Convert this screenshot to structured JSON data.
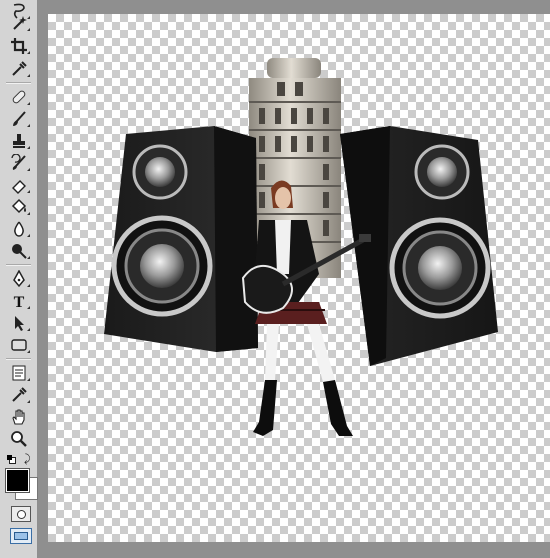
{
  "toolbar": {
    "tools": [
      {
        "name": "lasso-tool",
        "icon": "lasso-icon"
      },
      {
        "name": "magic-wand-tool",
        "icon": "magic-wand-icon"
      },
      {
        "name": "crop-tool",
        "icon": "crop-icon"
      },
      {
        "name": "eyedropper-tool",
        "icon": "eyedropper-icon"
      },
      {
        "name": "healing-brush-tool",
        "icon": "bandage-icon"
      },
      {
        "name": "brush-tool",
        "icon": "brush-icon"
      },
      {
        "name": "clone-stamp-tool",
        "icon": "stamp-icon"
      },
      {
        "name": "history-brush-tool",
        "icon": "history-brush-icon"
      },
      {
        "name": "eraser-tool",
        "icon": "eraser-icon"
      },
      {
        "name": "paint-bucket-tool",
        "icon": "paint-bucket-icon"
      },
      {
        "name": "blur-tool",
        "icon": "blur-icon"
      },
      {
        "name": "dodge-tool",
        "icon": "dodge-icon"
      },
      {
        "name": "pen-tool",
        "icon": "pen-icon"
      },
      {
        "name": "type-tool",
        "icon": "type-icon",
        "label": "T"
      },
      {
        "name": "path-selection-tool",
        "icon": "arrow-icon"
      },
      {
        "name": "shape-tool",
        "icon": "rectangle-icon"
      },
      {
        "name": "notes-tool",
        "icon": "notes-icon"
      },
      {
        "name": "color-sampler-tool",
        "icon": "eyedropper-icon"
      },
      {
        "name": "hand-tool",
        "icon": "hand-icon"
      },
      {
        "name": "zoom-tool",
        "icon": "magnifier-icon"
      }
    ],
    "foreground_color": "#000000",
    "background_color": "#ffffff"
  },
  "document": {
    "transparency_light": "#ffffff",
    "transparency_dark": "#cccccc",
    "layers": [
      "speaker-left",
      "leaning-tower",
      "guitarist",
      "speaker-right"
    ]
  }
}
